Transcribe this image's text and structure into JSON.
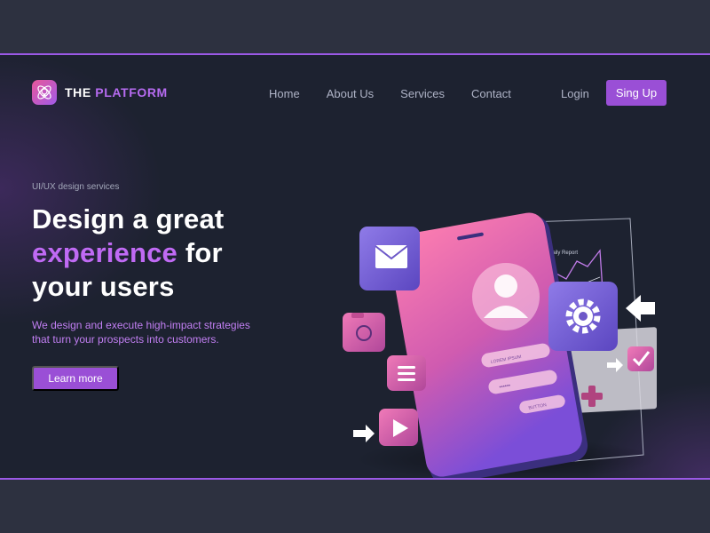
{
  "brand": {
    "name_part1": "THE ",
    "name_part2": "PLATFORM"
  },
  "nav": {
    "items": [
      {
        "label": "Home"
      },
      {
        "label": "About Us"
      },
      {
        "label": "Services"
      },
      {
        "label": "Contact"
      }
    ],
    "login_label": "Login",
    "signup_label": "Sing Up"
  },
  "hero": {
    "eyebrow": "UI/UX design services",
    "headline_line1": "Design a great",
    "headline_accent": "experience",
    "headline_line2_rest": " for",
    "headline_line3": "your users",
    "description_line1": "We design and execute high-impact strategies",
    "description_line2": "that turn your prospects into customers.",
    "cta_label": "Learn more"
  },
  "illustration": {
    "report_title": "Daily Report",
    "phone_field1": "LOREM IPSUM",
    "phone_field2": "••••••",
    "phone_button": "BUTTON"
  },
  "colors": {
    "page_bg": "#2d3140",
    "panel_bg": "#1d2230",
    "accent": "#9a4fd6",
    "accent_text": "#c06af4"
  }
}
